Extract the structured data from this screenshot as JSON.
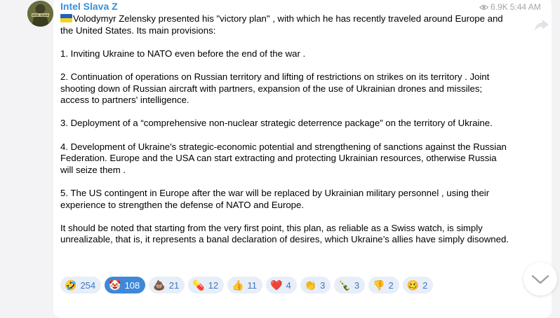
{
  "post": {
    "channel_name": "Intel Slava Z",
    "avatar_text": "INTEL SLAVA",
    "views": "6.9K",
    "time": "5:44 AM",
    "paragraphs": [
      "Volodymyr Zelensky presented his \"victory plan\" , with which he has recently traveled around Europe and the United States. Its main provisions:",
      "1. Inviting Ukraine to NATO even before the end of the war .",
      "2. Continuation of operations on Russian territory and lifting of restrictions on strikes on its territory . Joint shooting down of Russian aircraft with partners, expansion of the use of Ukrainian drones and missiles; access to partners' intelligence.",
      "3. Deployment of a “comprehensive non-nuclear strategic deterrence package” on the territory of Ukraine.",
      "4. Development of Ukraine's strategic-economic potential and strengthening of sanctions against the Russian Federation. Europe and the USA can start extracting and protecting Ukrainian resources, otherwise Russia will seize them .",
      "5. The US contingent in Europe after the war will be replaced by Ukrainian military personnel , using their experience to strengthen the defense of NATO and Europe.",
      "It should be noted that starting from the very first point, this plan, as reliable as a Swiss watch, is simply unrealizable, that is, it represents a banal declaration of desires, which Ukraine’s allies have simply disowned."
    ]
  },
  "reactions": [
    {
      "emoji": "🤣",
      "count": "254",
      "active": false
    },
    {
      "emoji": "🤡",
      "count": "108",
      "active": true
    },
    {
      "emoji": "💩",
      "count": "21",
      "active": false
    },
    {
      "emoji": "💊",
      "count": "12",
      "active": false
    },
    {
      "emoji": "👍",
      "count": "11",
      "active": false
    },
    {
      "emoji": "❤️",
      "count": "4",
      "active": false
    },
    {
      "emoji": "👏",
      "count": "3",
      "active": false
    },
    {
      "emoji": "🍾",
      "count": "3",
      "active": false
    },
    {
      "emoji": "👎",
      "count": "2",
      "active": false
    },
    {
      "emoji": "🥴",
      "count": "2",
      "active": false
    }
  ],
  "colors": {
    "accent": "#3a8ed8",
    "reaction_bg": "#e7eef8",
    "reaction_active_bg": "#3e88d9",
    "flag_blue": "#1f5fbf",
    "flag_yellow": "#f7d21b"
  },
  "icons": {
    "views": "eye-icon",
    "share": "share-arrow-icon",
    "scroll": "chevron-down-icon"
  }
}
